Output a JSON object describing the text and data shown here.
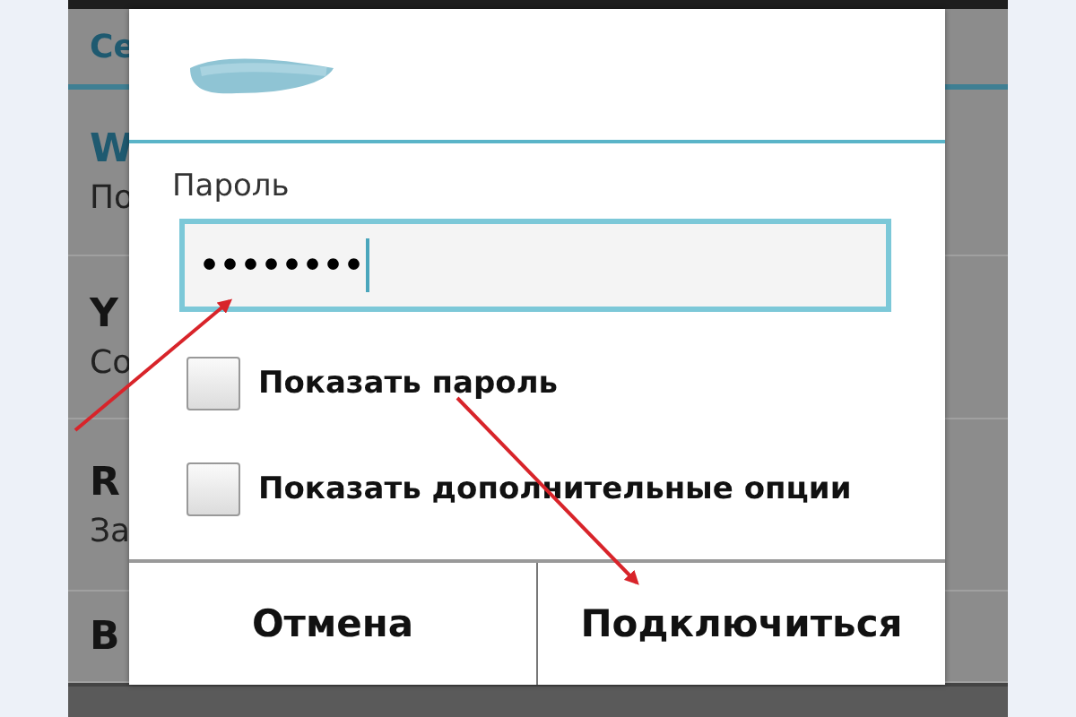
{
  "background_screen": {
    "tab": "Се",
    "networks": [
      {
        "name": "W",
        "status": "По",
        "highlighted": true
      },
      {
        "name": "Y",
        "status": "Со",
        "highlighted": false
      },
      {
        "name": "R",
        "status": "За",
        "highlighted": false
      },
      {
        "name": "B",
        "highlighted": false
      }
    ]
  },
  "dialog": {
    "password_label": "Пароль",
    "password": {
      "value": "••••••••",
      "focused": true
    },
    "options": [
      {
        "label": "Показать пароль",
        "checked": false
      },
      {
        "label": "Показать дополнительные опции",
        "checked": false
      }
    ],
    "buttons": [
      "Отмена",
      "Подключиться"
    ]
  },
  "annotations": [
    {
      "kind": "arrow"
    },
    {
      "kind": "arrow"
    }
  ]
}
